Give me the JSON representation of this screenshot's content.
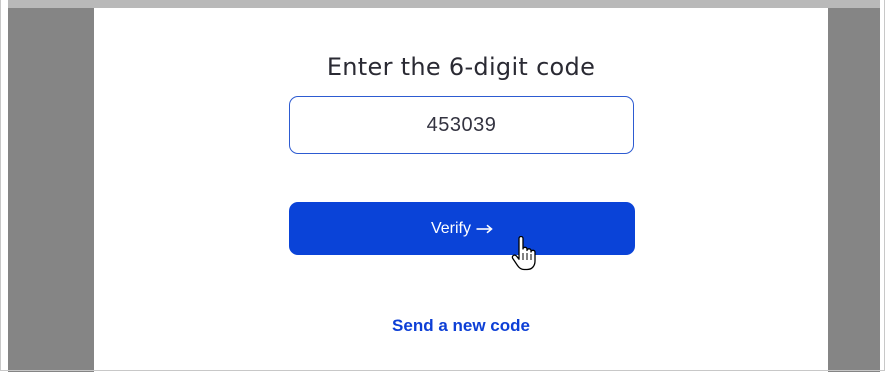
{
  "verification": {
    "heading": "Enter the 6-digit code",
    "code_value": "453039",
    "verify_label": "Verify",
    "verify_icon": "arrow-right-icon",
    "resend_label": "Send a new code"
  },
  "pointer": {
    "icon": "hand-pointer-icon"
  },
  "colors": {
    "accent": "#0a43d8",
    "input_border": "#2d5bd1",
    "link": "#0d3fd6",
    "backdrop": "#858585"
  }
}
